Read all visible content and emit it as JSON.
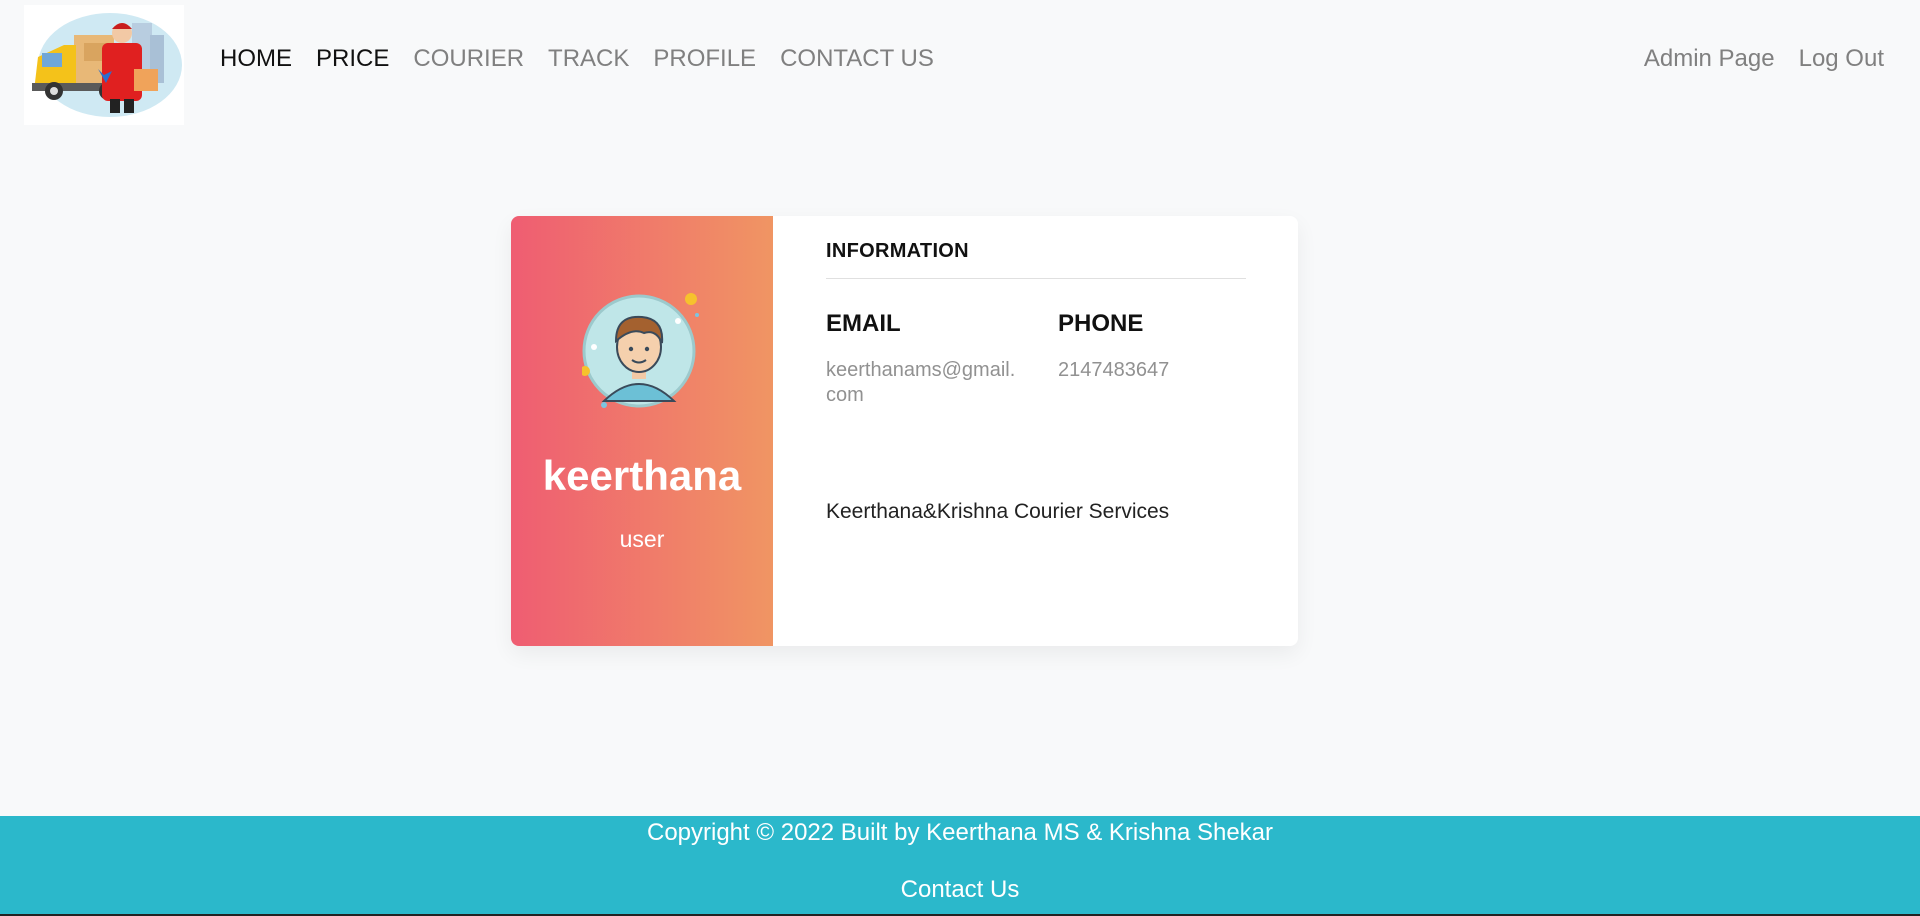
{
  "nav": {
    "logo_alt": "Courier delivery logo",
    "links": [
      {
        "label": "HOME",
        "active": true
      },
      {
        "label": "PRICE",
        "active": true
      },
      {
        "label": "COURIER",
        "active": false
      },
      {
        "label": "TRACK",
        "active": false
      },
      {
        "label": "PROFILE",
        "active": false
      },
      {
        "label": "CONTACT US",
        "active": false
      }
    ],
    "right_links": [
      {
        "label": "Admin Page"
      },
      {
        "label": "Log Out"
      }
    ]
  },
  "profile": {
    "name": "keerthana",
    "role": "user",
    "info_heading": "INFORMATION",
    "email_label": "EMAIL",
    "email_value": "keerthanams@gmail.com",
    "phone_label": "PHONE",
    "phone_value": "2147483647",
    "company": "Keerthana&Krishna Courier Services"
  },
  "footer": {
    "copyright": "Copyright © 2022 Built by Keerthana MS & Krishna Shekar",
    "contact_label": "Contact Us"
  },
  "colors": {
    "page_bg": "#f8f9fa",
    "card_gradient_start": "#ef5d72",
    "card_gradient_end": "#f09563",
    "footer_bg": "#2bb8cb",
    "muted_text": "#808080"
  }
}
